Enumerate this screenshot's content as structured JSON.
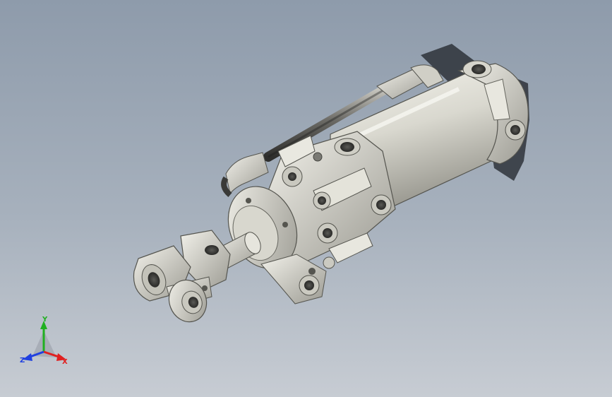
{
  "viewport": {
    "background_top": "#8e9bab",
    "background_bottom": "#c7ccd3"
  },
  "model": {
    "part_color": "#dcdbd2",
    "shadow_color": "#3a3f48"
  },
  "triad": {
    "x_label": "X",
    "y_label": "Y",
    "z_label": "Z",
    "x_color": "#e02020",
    "y_color": "#20b020",
    "z_color": "#2040e0"
  }
}
